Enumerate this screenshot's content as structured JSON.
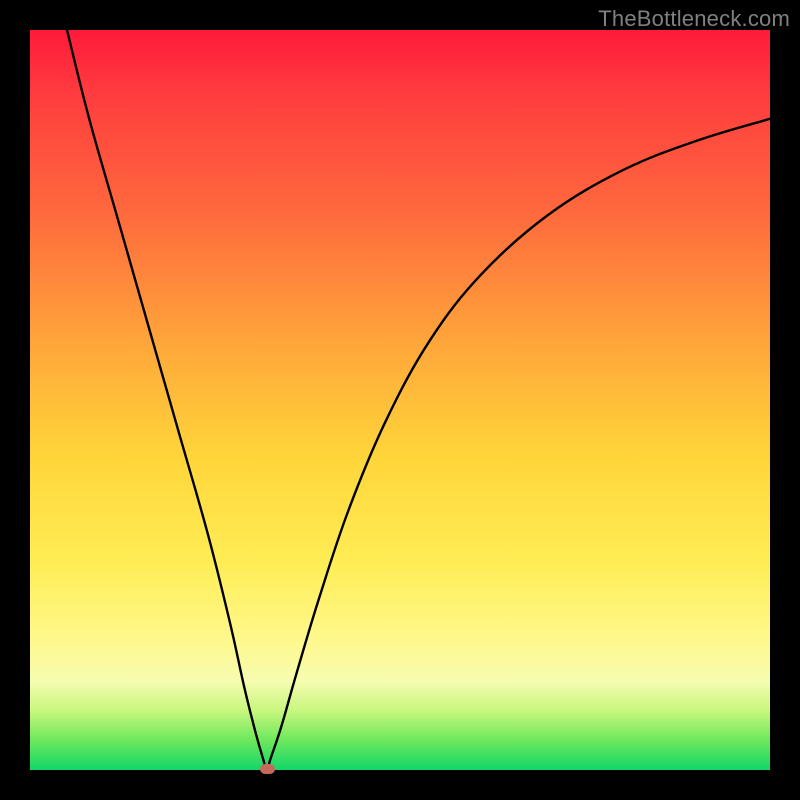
{
  "watermark": "TheBottleneck.com",
  "colors": {
    "frame": "#000000",
    "watermark": "#808080",
    "curve": "#000000",
    "dot": "#c56a5a",
    "gradient_stops": [
      "#ff1a3a",
      "#ff3a3f",
      "#ff6a3d",
      "#ffa53a",
      "#ffd63a",
      "#ffed55",
      "#fff88a",
      "#f6fcb0",
      "#c8f77e",
      "#6de85c",
      "#12d66a"
    ]
  },
  "chart_data": {
    "type": "line",
    "title": "",
    "xlabel": "",
    "ylabel": "",
    "xlim": [
      0,
      100
    ],
    "ylim": [
      0,
      100
    ],
    "grid": false,
    "legend": false,
    "minimum_point": {
      "x": 32,
      "y": 0
    },
    "series": [
      {
        "name": "bottleneck-curve",
        "x": [
          5,
          8,
          12,
          16,
          20,
          24,
          27,
          29,
          30.5,
          31.5,
          32,
          32.5,
          34,
          36,
          39,
          43,
          48,
          54,
          61,
          70,
          80,
          90,
          100
        ],
        "y": [
          100,
          88,
          74,
          60,
          46,
          32,
          20,
          11,
          5,
          1.5,
          0,
          1.5,
          6,
          13,
          23,
          35,
          47,
          58,
          67,
          75,
          81,
          85,
          88
        ]
      }
    ],
    "annotations": [
      {
        "name": "optimal-dot",
        "x": 32,
        "y": 0
      }
    ]
  }
}
